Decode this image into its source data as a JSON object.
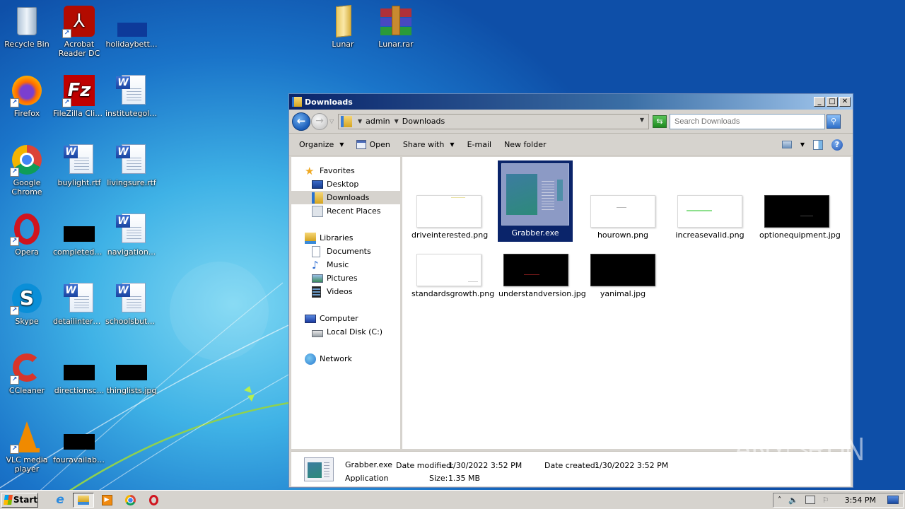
{
  "desktop": {
    "icons": [
      {
        "label": "Recycle Bin",
        "icon": "recycle-bin-icon"
      },
      {
        "label": "Acrobat Reader DC",
        "icon": "acrobat-reader-icon"
      },
      {
        "label": "holidaybett...",
        "icon": "image-file-icon"
      },
      {
        "label": "Firefox",
        "icon": "firefox-icon"
      },
      {
        "label": "FileZilla Client",
        "icon": "filezilla-icon"
      },
      {
        "label": "institutegold...",
        "icon": "word-document-icon"
      },
      {
        "label": "Google Chrome",
        "icon": "chrome-icon"
      },
      {
        "label": "buylight.rtf",
        "icon": "word-document-icon"
      },
      {
        "label": "livingsure.rtf",
        "icon": "word-document-icon"
      },
      {
        "label": "Opera",
        "icon": "opera-icon"
      },
      {
        "label": "completedc...",
        "icon": "image-file-icon"
      },
      {
        "label": "navigation...",
        "icon": "word-document-icon"
      },
      {
        "label": "Skype",
        "icon": "skype-icon"
      },
      {
        "label": "detailinteres...",
        "icon": "word-document-icon"
      },
      {
        "label": "schoolsbutt...",
        "icon": "word-document-icon"
      },
      {
        "label": "CCleaner",
        "icon": "ccleaner-icon"
      },
      {
        "label": "directionsc...",
        "icon": "image-file-icon"
      },
      {
        "label": "thinglists.jpg",
        "icon": "image-file-icon"
      },
      {
        "label": "VLC media player",
        "icon": "vlc-icon"
      },
      {
        "label": "fouravailabil...",
        "icon": "image-file-icon"
      },
      {
        "label": "Lunar",
        "icon": "folder-icon"
      },
      {
        "label": "Lunar.rar",
        "icon": "winrar-archive-icon"
      }
    ]
  },
  "window": {
    "title": "Downloads",
    "controls": {
      "minimize": "_",
      "maximize": "□",
      "close": "✕"
    },
    "breadcrumb": [
      "admin",
      "Downloads"
    ],
    "search_placeholder": "Search Downloads",
    "toolbar": {
      "organize": "Organize",
      "open": "Open",
      "share_with": "Share with",
      "email": "E-mail",
      "new_folder": "New folder"
    },
    "nav": {
      "favorites": "Favorites",
      "favorites_items": [
        "Desktop",
        "Downloads",
        "Recent Places"
      ],
      "libraries": "Libraries",
      "libraries_items": [
        "Documents",
        "Music",
        "Pictures",
        "Videos"
      ],
      "computer": "Computer",
      "computer_items": [
        "Local Disk (C:)"
      ],
      "network": "Network",
      "selected": "Downloads"
    },
    "files": [
      {
        "name": "driveinterested.png",
        "thumb": "white"
      },
      {
        "name": "Grabber.exe",
        "thumb": "exe",
        "selected": true
      },
      {
        "name": "hourown.png",
        "thumb": "white"
      },
      {
        "name": "increasevalid.png",
        "thumb": "white"
      },
      {
        "name": "optionequipment.jpg",
        "thumb": "black"
      },
      {
        "name": "standardsgrowth.png",
        "thumb": "white"
      },
      {
        "name": "understandversion.jpg",
        "thumb": "black"
      },
      {
        "name": "yanimal.jpg",
        "thumb": "black"
      }
    ],
    "details": {
      "name": "Grabber.exe",
      "type": "Application",
      "date_modified_label": "Date modified:",
      "date_modified": "1/30/2022 3:52 PM",
      "date_created_label": "Date created:",
      "date_created": "1/30/2022 3:52 PM",
      "size_label": "Size:",
      "size": "1.35 MB"
    }
  },
  "taskbar": {
    "start_label": "Start",
    "apps": [
      "Internet Explorer",
      "Windows Explorer",
      "Windows Media Player",
      "Google Chrome",
      "Opera"
    ],
    "clock": "3:54 PM"
  },
  "watermark": "ANY▷RUN"
}
